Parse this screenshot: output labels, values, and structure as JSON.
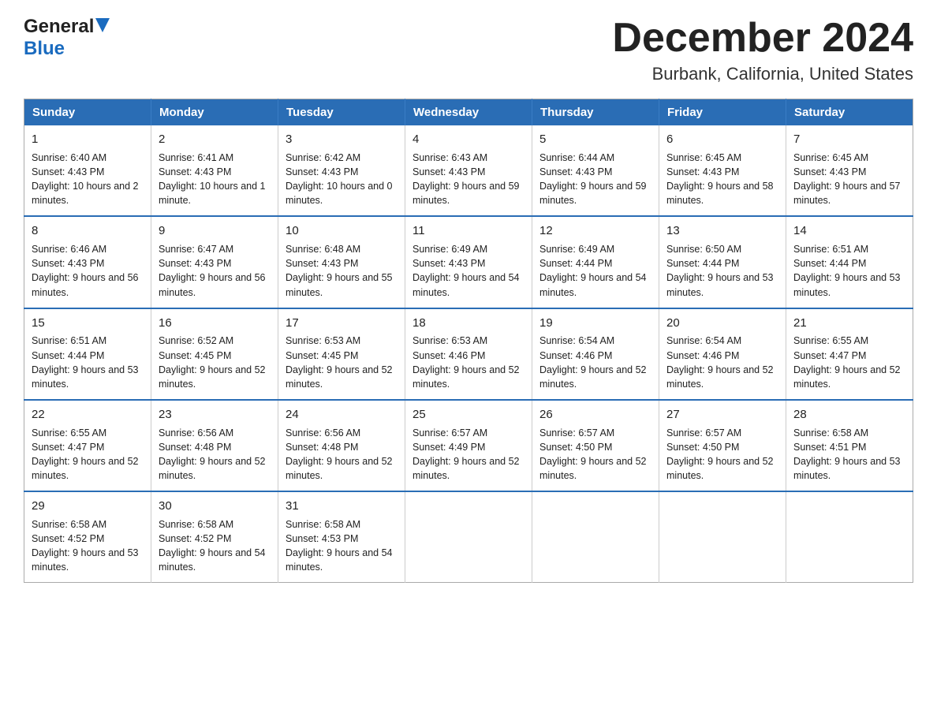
{
  "header": {
    "logo_general": "General",
    "logo_blue": "Blue",
    "month_title": "December 2024",
    "location": "Burbank, California, United States"
  },
  "days_of_week": [
    "Sunday",
    "Monday",
    "Tuesday",
    "Wednesday",
    "Thursday",
    "Friday",
    "Saturday"
  ],
  "weeks": [
    [
      {
        "day": "1",
        "sunrise": "6:40 AM",
        "sunset": "4:43 PM",
        "daylight": "10 hours and 2 minutes."
      },
      {
        "day": "2",
        "sunrise": "6:41 AM",
        "sunset": "4:43 PM",
        "daylight": "10 hours and 1 minute."
      },
      {
        "day": "3",
        "sunrise": "6:42 AM",
        "sunset": "4:43 PM",
        "daylight": "10 hours and 0 minutes."
      },
      {
        "day": "4",
        "sunrise": "6:43 AM",
        "sunset": "4:43 PM",
        "daylight": "9 hours and 59 minutes."
      },
      {
        "day": "5",
        "sunrise": "6:44 AM",
        "sunset": "4:43 PM",
        "daylight": "9 hours and 59 minutes."
      },
      {
        "day": "6",
        "sunrise": "6:45 AM",
        "sunset": "4:43 PM",
        "daylight": "9 hours and 58 minutes."
      },
      {
        "day": "7",
        "sunrise": "6:45 AM",
        "sunset": "4:43 PM",
        "daylight": "9 hours and 57 minutes."
      }
    ],
    [
      {
        "day": "8",
        "sunrise": "6:46 AM",
        "sunset": "4:43 PM",
        "daylight": "9 hours and 56 minutes."
      },
      {
        "day": "9",
        "sunrise": "6:47 AM",
        "sunset": "4:43 PM",
        "daylight": "9 hours and 56 minutes."
      },
      {
        "day": "10",
        "sunrise": "6:48 AM",
        "sunset": "4:43 PM",
        "daylight": "9 hours and 55 minutes."
      },
      {
        "day": "11",
        "sunrise": "6:49 AM",
        "sunset": "4:43 PM",
        "daylight": "9 hours and 54 minutes."
      },
      {
        "day": "12",
        "sunrise": "6:49 AM",
        "sunset": "4:44 PM",
        "daylight": "9 hours and 54 minutes."
      },
      {
        "day": "13",
        "sunrise": "6:50 AM",
        "sunset": "4:44 PM",
        "daylight": "9 hours and 53 minutes."
      },
      {
        "day": "14",
        "sunrise": "6:51 AM",
        "sunset": "4:44 PM",
        "daylight": "9 hours and 53 minutes."
      }
    ],
    [
      {
        "day": "15",
        "sunrise": "6:51 AM",
        "sunset": "4:44 PM",
        "daylight": "9 hours and 53 minutes."
      },
      {
        "day": "16",
        "sunrise": "6:52 AM",
        "sunset": "4:45 PM",
        "daylight": "9 hours and 52 minutes."
      },
      {
        "day": "17",
        "sunrise": "6:53 AM",
        "sunset": "4:45 PM",
        "daylight": "9 hours and 52 minutes."
      },
      {
        "day": "18",
        "sunrise": "6:53 AM",
        "sunset": "4:46 PM",
        "daylight": "9 hours and 52 minutes."
      },
      {
        "day": "19",
        "sunrise": "6:54 AM",
        "sunset": "4:46 PM",
        "daylight": "9 hours and 52 minutes."
      },
      {
        "day": "20",
        "sunrise": "6:54 AM",
        "sunset": "4:46 PM",
        "daylight": "9 hours and 52 minutes."
      },
      {
        "day": "21",
        "sunrise": "6:55 AM",
        "sunset": "4:47 PM",
        "daylight": "9 hours and 52 minutes."
      }
    ],
    [
      {
        "day": "22",
        "sunrise": "6:55 AM",
        "sunset": "4:47 PM",
        "daylight": "9 hours and 52 minutes."
      },
      {
        "day": "23",
        "sunrise": "6:56 AM",
        "sunset": "4:48 PM",
        "daylight": "9 hours and 52 minutes."
      },
      {
        "day": "24",
        "sunrise": "6:56 AM",
        "sunset": "4:48 PM",
        "daylight": "9 hours and 52 minutes."
      },
      {
        "day": "25",
        "sunrise": "6:57 AM",
        "sunset": "4:49 PM",
        "daylight": "9 hours and 52 minutes."
      },
      {
        "day": "26",
        "sunrise": "6:57 AM",
        "sunset": "4:50 PM",
        "daylight": "9 hours and 52 minutes."
      },
      {
        "day": "27",
        "sunrise": "6:57 AM",
        "sunset": "4:50 PM",
        "daylight": "9 hours and 52 minutes."
      },
      {
        "day": "28",
        "sunrise": "6:58 AM",
        "sunset": "4:51 PM",
        "daylight": "9 hours and 53 minutes."
      }
    ],
    [
      {
        "day": "29",
        "sunrise": "6:58 AM",
        "sunset": "4:52 PM",
        "daylight": "9 hours and 53 minutes."
      },
      {
        "day": "30",
        "sunrise": "6:58 AM",
        "sunset": "4:52 PM",
        "daylight": "9 hours and 54 minutes."
      },
      {
        "day": "31",
        "sunrise": "6:58 AM",
        "sunset": "4:53 PM",
        "daylight": "9 hours and 54 minutes."
      },
      null,
      null,
      null,
      null
    ]
  ]
}
